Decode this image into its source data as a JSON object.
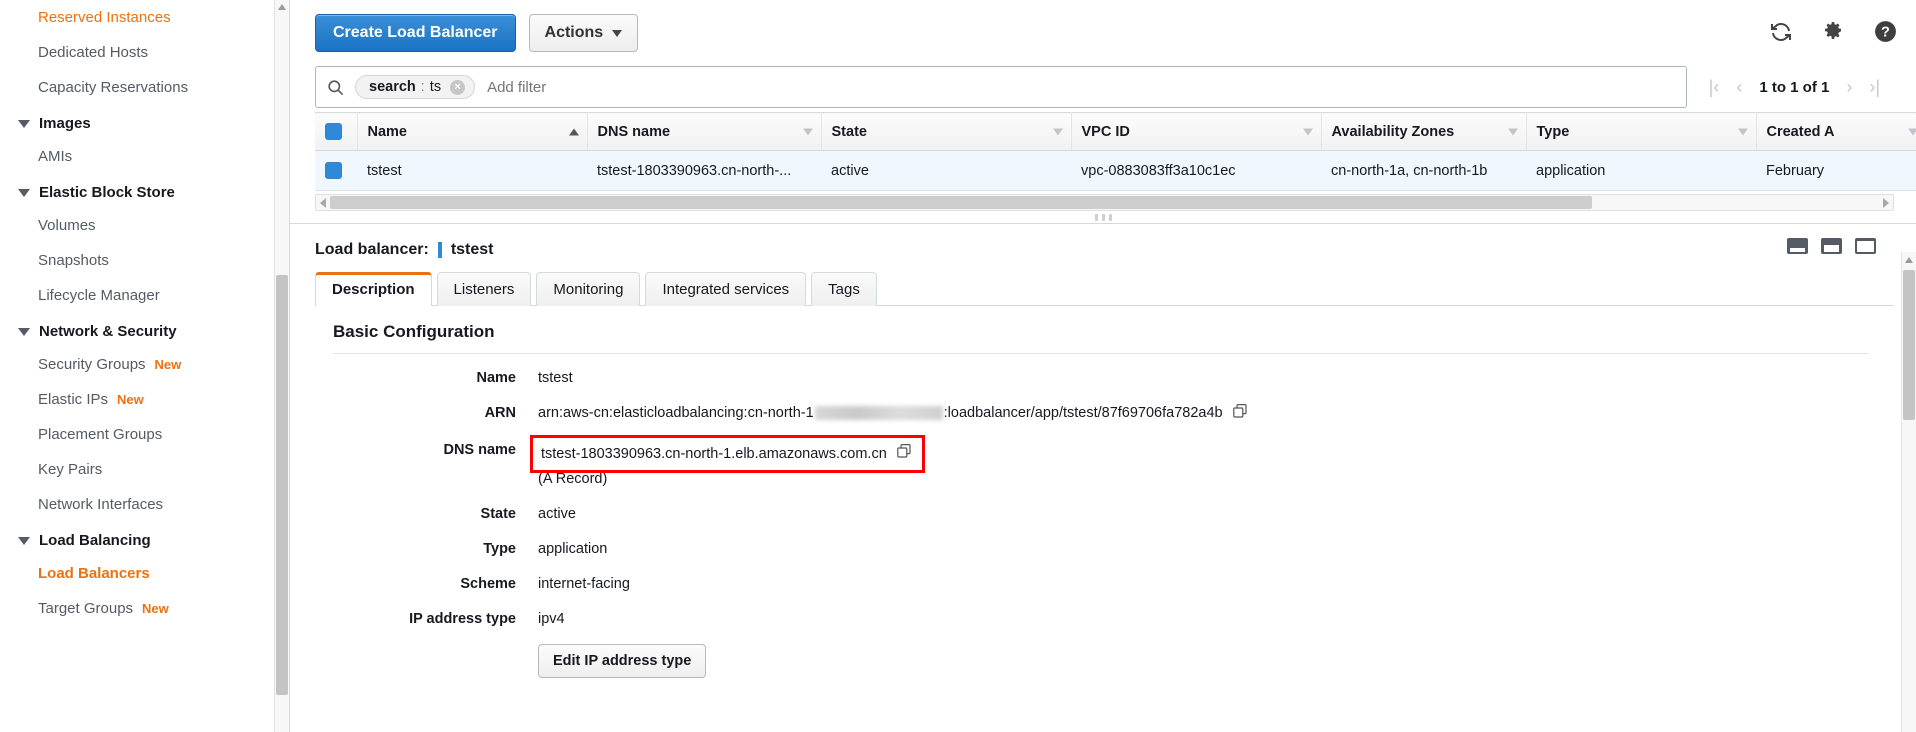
{
  "sidebar": {
    "items": [
      {
        "type": "link",
        "label": "Reserved Instances",
        "badge": "",
        "selected": false
      },
      {
        "type": "link",
        "label": "Dedicated Hosts",
        "badge": "",
        "selected": false
      },
      {
        "type": "link",
        "label": "Capacity Reservations",
        "badge": "",
        "selected": false
      },
      {
        "type": "group",
        "label": "Images"
      },
      {
        "type": "link",
        "label": "AMIs",
        "badge": "",
        "selected": false
      },
      {
        "type": "group",
        "label": "Elastic Block Store"
      },
      {
        "type": "link",
        "label": "Volumes",
        "badge": "",
        "selected": false
      },
      {
        "type": "link",
        "label": "Snapshots",
        "badge": "",
        "selected": false
      },
      {
        "type": "link",
        "label": "Lifecycle Manager",
        "badge": "",
        "selected": false
      },
      {
        "type": "group",
        "label": "Network & Security"
      },
      {
        "type": "link",
        "label": "Security Groups",
        "badge": "New",
        "selected": false
      },
      {
        "type": "link",
        "label": "Elastic IPs",
        "badge": "New",
        "selected": false
      },
      {
        "type": "link",
        "label": "Placement Groups",
        "badge": "",
        "selected": false
      },
      {
        "type": "link",
        "label": "Key Pairs",
        "badge": "",
        "selected": false
      },
      {
        "type": "link",
        "label": "Network Interfaces",
        "badge": "",
        "selected": false
      },
      {
        "type": "group",
        "label": "Load Balancing"
      },
      {
        "type": "link",
        "label": "Load Balancers",
        "badge": "",
        "selected": true
      },
      {
        "type": "link",
        "label": "Target Groups",
        "badge": "New",
        "selected": false
      }
    ]
  },
  "toolbar": {
    "create_label": "Create Load Balancer",
    "actions_label": "Actions",
    "refresh_icon": "refresh-icon",
    "settings_icon": "gear-icon",
    "help_icon": "help-icon"
  },
  "filter": {
    "search_icon": "search-icon",
    "pill_key": "search",
    "pill_separator": ":",
    "pill_value": "ts",
    "pill_clear": "×",
    "placeholder": "Add filter",
    "value": ""
  },
  "pagination": {
    "first": "|‹",
    "prev": "‹",
    "count": "1 to 1 of 1",
    "next": "›",
    "last": "›|"
  },
  "table": {
    "columns": [
      {
        "label": "Name",
        "sort": "asc"
      },
      {
        "label": "DNS name",
        "sort": "none"
      },
      {
        "label": "State",
        "sort": "none"
      },
      {
        "label": "VPC ID",
        "sort": "none"
      },
      {
        "label": "Availability Zones",
        "sort": "none"
      },
      {
        "label": "Type",
        "sort": "none"
      },
      {
        "label": "Created A",
        "sort": "none"
      }
    ],
    "rows": [
      {
        "selected": true,
        "name": "tstest",
        "dns_name": "tstest-1803390963.cn-north-...",
        "state": "active",
        "vpc_id": "vpc-0883083ff3a10c1ec",
        "availability_zones": "cn-north-1a, cn-north-1b",
        "type": "application",
        "created_at": "February"
      }
    ]
  },
  "detail": {
    "header_label": "Load balancer:",
    "header_value": "tstest",
    "tabs": [
      {
        "label": "Description",
        "active": true
      },
      {
        "label": "Listeners",
        "active": false
      },
      {
        "label": "Monitoring",
        "active": false
      },
      {
        "label": "Integrated services",
        "active": false
      },
      {
        "label": "Tags",
        "active": false
      }
    ],
    "section_title": "Basic Configuration",
    "fields": {
      "name_label": "Name",
      "name_value": "tstest",
      "arn_label": "ARN",
      "arn_prefix": "arn:aws-cn:elasticloadbalancing:cn-north-1",
      "arn_suffix": ":loadbalancer/app/tstest/87f69706fa782a4b",
      "dns_label": "DNS name",
      "dns_value": "tstest-1803390963.cn-north-1.elb.amazonaws.com.cn",
      "dns_record_note": "(A Record)",
      "state_label": "State",
      "state_value": "active",
      "type_label": "Type",
      "type_value": "application",
      "scheme_label": "Scheme",
      "scheme_value": "internet-facing",
      "ip_type_label": "IP address type",
      "ip_type_value": "ipv4",
      "edit_ip_label": "Edit IP address type"
    },
    "panel_icons": [
      "panel-small-icon",
      "panel-medium-icon",
      "panel-large-icon"
    ]
  },
  "colors": {
    "accent_orange": "#ec7211",
    "primary_blue": "#1a73c4",
    "highlight_red": "#ff0000",
    "selected_row": "#f0f7ff"
  }
}
